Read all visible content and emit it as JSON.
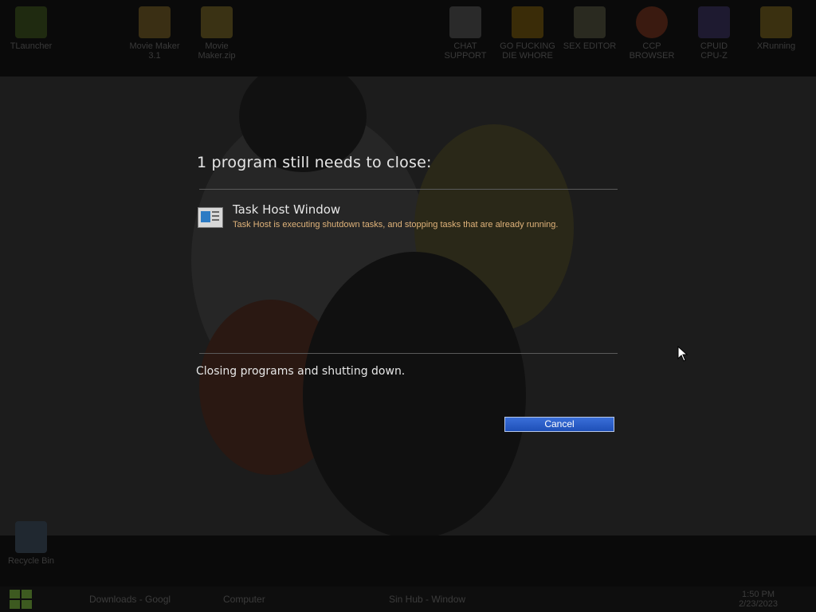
{
  "dialog": {
    "title": "1 program still needs to close:",
    "program_name": "Task Host Window",
    "program_description": "Task Host is executing shutdown tasks, and stopping tasks that are already running.",
    "status": "Closing programs and shutting down.",
    "cancel_label": "Cancel"
  },
  "desktop_icons": [
    {
      "label": "TLauncher",
      "color": "#1f2a10"
    },
    {
      "label": "Movie Maker\n3.1",
      "color": "#3a2f14"
    },
    {
      "label": "Movie\nMaker.zip",
      "color": "#3a3214"
    },
    {
      "label": "CHAT\nSUPPORT",
      "color": "#2a2a2a"
    },
    {
      "label": "GO FUCKING\nDIE WHORE",
      "color": "#3a2c08"
    },
    {
      "label": "SEX EDITOR",
      "color": "#2a2a20"
    },
    {
      "label": "CCP\nBROWSER",
      "color": "#3a1a10"
    },
    {
      "label": "CPUID\nCPU-Z",
      "color": "#1e1a30"
    },
    {
      "label": "XRunning",
      "color": "#3a3010"
    },
    {
      "label": "Recycle Bin",
      "color": "#202830"
    }
  ],
  "taskbar": {
    "items": [
      "Downloads - Googl",
      "Computer",
      "Sin Hub - Window"
    ],
    "time": "1:50 PM",
    "date": "2/23/2023"
  },
  "colors": {
    "accent": "#2b5fd0",
    "warning_text": "#e0b37a"
  }
}
